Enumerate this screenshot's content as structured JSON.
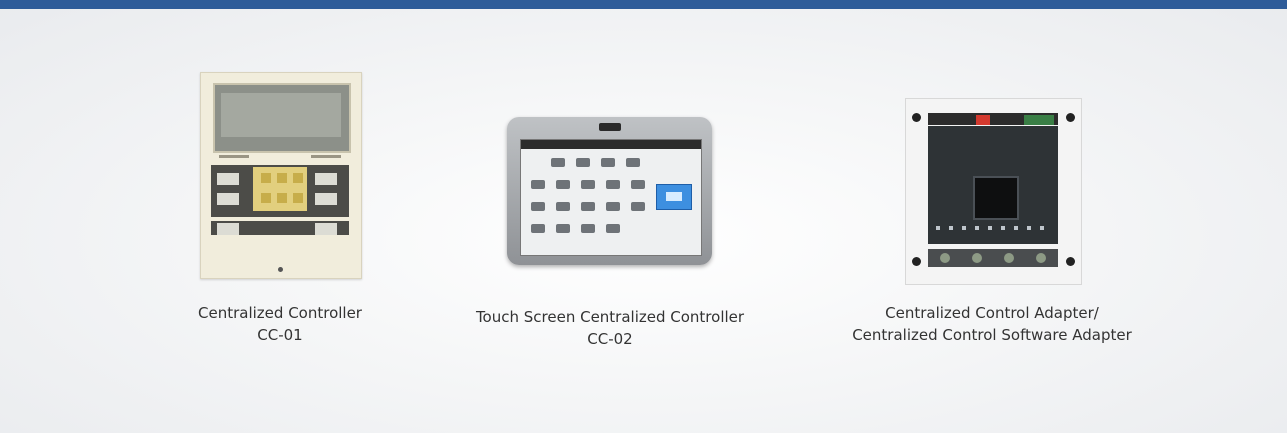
{
  "header": {
    "accent_color": "#2e5c99"
  },
  "products": [
    {
      "line1": "Centralized Controller",
      "line2": "CC-01"
    },
    {
      "line1": "Touch Screen Centralized Controller",
      "line2": "CC-02"
    },
    {
      "line1": "Centralized Control Adapter/",
      "line2": "Centralized Control Software Adapter"
    }
  ]
}
